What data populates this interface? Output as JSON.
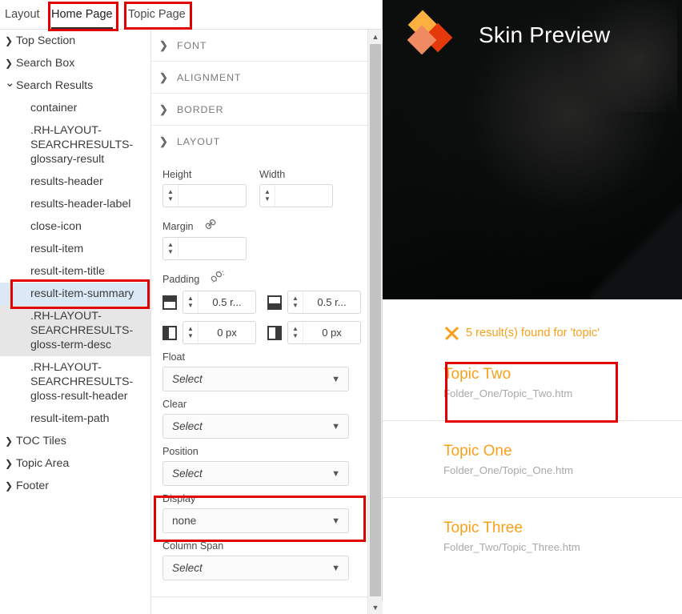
{
  "tabs": [
    {
      "label": "Layout",
      "active": false
    },
    {
      "label": "Home Page",
      "active": true
    },
    {
      "label": "Topic Page",
      "active": false
    }
  ],
  "tree": {
    "nodes": [
      {
        "label": "Top Section",
        "type": "group",
        "expanded": false
      },
      {
        "label": "Search Box",
        "type": "group",
        "expanded": false
      },
      {
        "label": "Search Results",
        "type": "group",
        "expanded": true
      },
      {
        "label": "container",
        "type": "child",
        "state": "normal"
      },
      {
        "label": ".RH-LAYOUT-SEARCHRESULTS-glossary-result",
        "type": "child",
        "state": "normal"
      },
      {
        "label": "results-header",
        "type": "child",
        "state": "normal"
      },
      {
        "label": "results-header-label",
        "type": "child",
        "state": "normal"
      },
      {
        "label": "close-icon",
        "type": "child",
        "state": "normal"
      },
      {
        "label": "result-item",
        "type": "child",
        "state": "normal"
      },
      {
        "label": "result-item-title",
        "type": "child",
        "state": "normal"
      },
      {
        "label": "result-item-summary",
        "type": "child",
        "state": "selected"
      },
      {
        "label": ".RH-LAYOUT-SEARCHRESULTS-gloss-term-desc",
        "type": "child",
        "state": "highlighted"
      },
      {
        "label": ".RH-LAYOUT-SEARCHRESULTS-gloss-result-header",
        "type": "child",
        "state": "normal"
      },
      {
        "label": "result-item-path",
        "type": "child",
        "state": "normal"
      },
      {
        "label": "TOC Tiles",
        "type": "group",
        "expanded": false
      },
      {
        "label": "Topic Area",
        "type": "group",
        "expanded": false
      },
      {
        "label": "Footer",
        "type": "group",
        "expanded": false
      }
    ]
  },
  "properties": {
    "sections": [
      {
        "title": "FONT",
        "expanded": false
      },
      {
        "title": "ALIGNMENT",
        "expanded": false
      },
      {
        "title": "BORDER",
        "expanded": false
      },
      {
        "title": "LAYOUT",
        "expanded": true
      }
    ],
    "layout": {
      "height_label": "Height",
      "height_value": "",
      "width_label": "Width",
      "width_value": "",
      "margin_label": "Margin",
      "margin_value": "",
      "margin_link_icon": "chain-linked-icon",
      "padding_label": "Padding",
      "padding_link_icon": "chain-broken-icon",
      "padding_top": "0.5 r...",
      "padding_bottom": "0.5 r...",
      "padding_left": "0 px",
      "padding_right": "0 px",
      "float_label": "Float",
      "float_value": "Select",
      "clear_label": "Clear",
      "clear_value": "Select",
      "position_label": "Position",
      "position_value": "Select",
      "display_label": "Display",
      "display_value": "none",
      "column_span_label": "Column Span",
      "column_span_value": "Select"
    }
  },
  "scrollbar": {
    "up_arrow_icon": "triangle-up-icon",
    "down_arrow_icon": "triangle-down-icon"
  },
  "preview": {
    "title": "Skin Preview",
    "logo_icon": "three-diamonds-logo-icon",
    "results_header": {
      "close_icon": "close-x-icon",
      "label": "5 result(s) found for 'topic'"
    },
    "results": [
      {
        "title": "Topic Two",
        "path": "Folder_One/Topic_Two.htm",
        "highlighted": true
      },
      {
        "title": "Topic One",
        "path": "Folder_One/Topic_One.htm",
        "highlighted": false
      },
      {
        "title": "Topic Three",
        "path": "Folder_Two/Topic_Three.htm",
        "highlighted": false
      }
    ]
  },
  "colors": {
    "accent_orange": "#f9a01b",
    "logo_yellow": "#fbb040",
    "logo_red": "#e5380b",
    "logo_salmon": "#ef8a63",
    "annotation_red": "#e00000",
    "selection_blue": "#dbe9f7",
    "hero_dark": "#0a0c0c"
  }
}
